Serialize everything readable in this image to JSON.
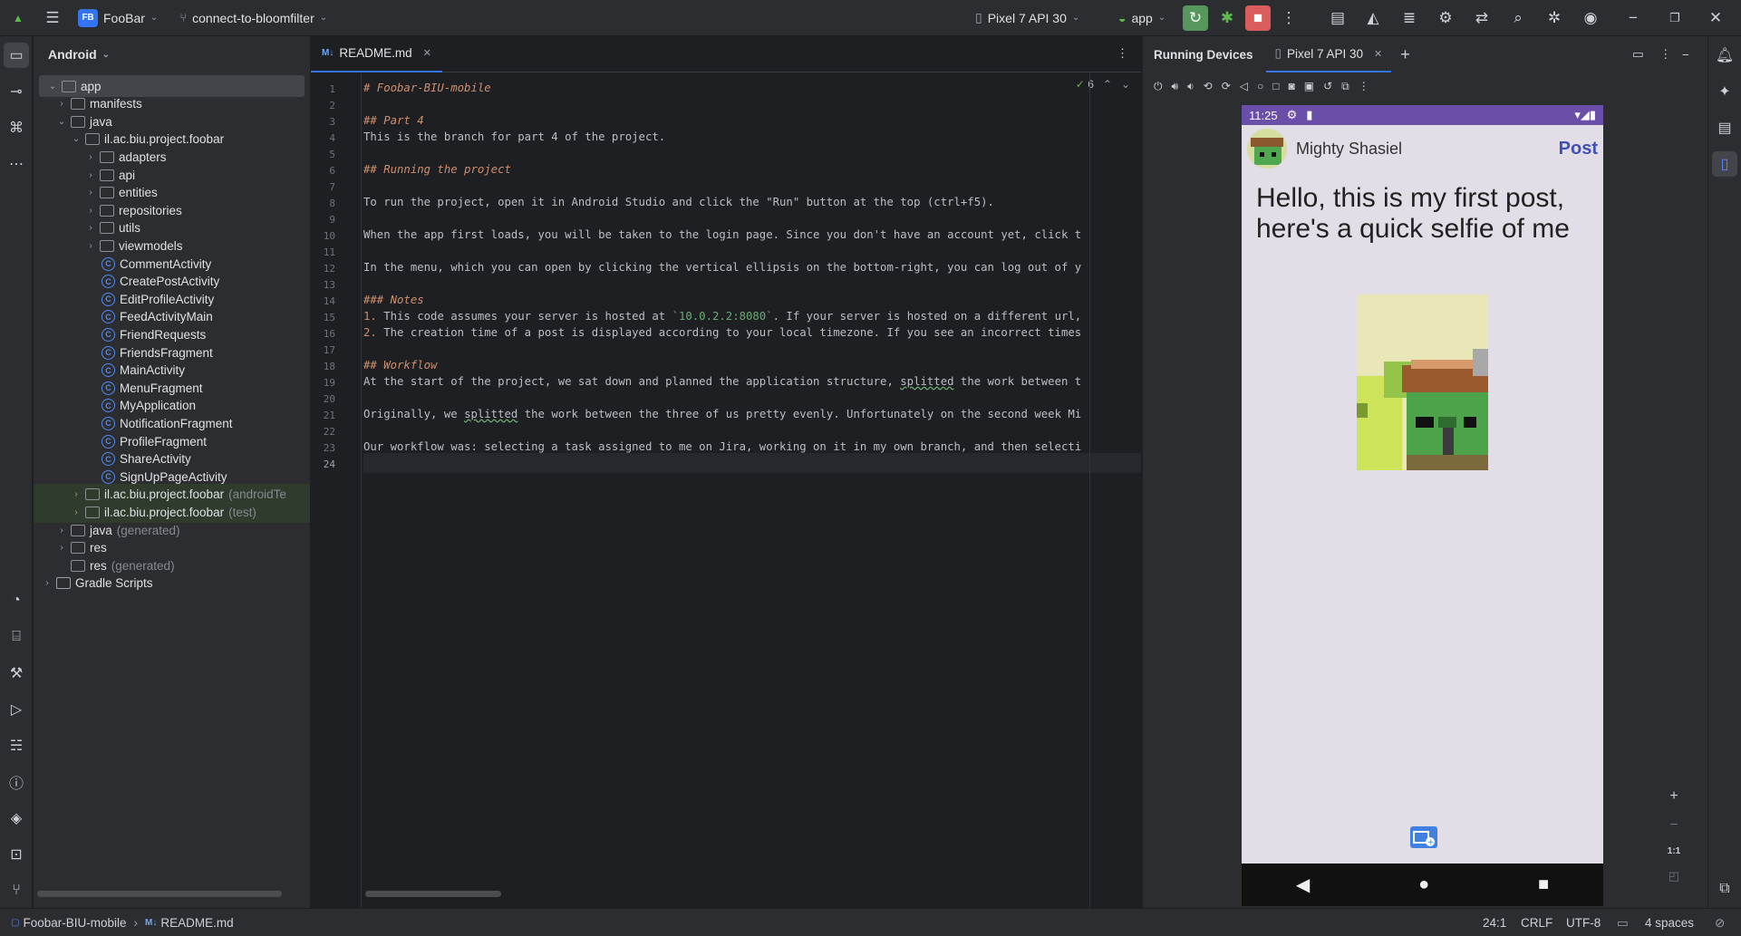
{
  "titlebar": {
    "project_badge": "FB",
    "project_name": "FooBar",
    "branch": "connect-to-bloomfilter",
    "device": "Pixel 7 API 30",
    "run_config": "app"
  },
  "project_panel": {
    "view_mode": "Android",
    "tree": [
      {
        "label": "app",
        "suffix": "",
        "kind": "module",
        "expanded": true
      },
      {
        "label": "manifests",
        "suffix": "",
        "kind": "folder"
      },
      {
        "label": "java",
        "suffix": "",
        "kind": "folder",
        "expanded": true
      },
      {
        "label": "il.ac.biu.project.foobar",
        "suffix": "",
        "kind": "package",
        "expanded": true
      },
      {
        "label": "adapters",
        "suffix": "",
        "kind": "package"
      },
      {
        "label": "api",
        "suffix": "",
        "kind": "package"
      },
      {
        "label": "entities",
        "suffix": "",
        "kind": "package"
      },
      {
        "label": "repositories",
        "suffix": "",
        "kind": "package"
      },
      {
        "label": "utils",
        "suffix": "",
        "kind": "package"
      },
      {
        "label": "viewmodels",
        "suffix": "",
        "kind": "package"
      },
      {
        "label": "CommentActivity",
        "suffix": "",
        "kind": "class"
      },
      {
        "label": "CreatePostActivity",
        "suffix": "",
        "kind": "class"
      },
      {
        "label": "EditProfileActivity",
        "suffix": "",
        "kind": "class"
      },
      {
        "label": "FeedActivityMain",
        "suffix": "",
        "kind": "class"
      },
      {
        "label": "FriendRequests",
        "suffix": "",
        "kind": "class"
      },
      {
        "label": "FriendsFragment",
        "suffix": "",
        "kind": "class"
      },
      {
        "label": "MainActivity",
        "suffix": "",
        "kind": "class"
      },
      {
        "label": "MenuFragment",
        "suffix": "",
        "kind": "class"
      },
      {
        "label": "MyApplication",
        "suffix": "",
        "kind": "class"
      },
      {
        "label": "NotificationFragment",
        "suffix": "",
        "kind": "class"
      },
      {
        "label": "ProfileFragment",
        "suffix": "",
        "kind": "class"
      },
      {
        "label": "ShareActivity",
        "suffix": "",
        "kind": "class"
      },
      {
        "label": "SignUpPageActivity",
        "suffix": "",
        "kind": "class"
      },
      {
        "label": "il.ac.biu.project.foobar",
        "suffix": "(androidTe",
        "kind": "package-test"
      },
      {
        "label": "il.ac.biu.project.foobar",
        "suffix": "(test)",
        "kind": "package-test"
      },
      {
        "label": "java",
        "suffix": "(generated)",
        "kind": "folder"
      },
      {
        "label": "res",
        "suffix": "",
        "kind": "folder"
      },
      {
        "label": "res",
        "suffix": "(generated)",
        "kind": "folder-noarrow"
      },
      {
        "label": "Gradle Scripts",
        "suffix": "",
        "kind": "gradle"
      }
    ]
  },
  "editor": {
    "tab_badge": "M↓",
    "tab_label": "README.md",
    "inspections_count": "6",
    "lines": [
      {
        "n": "1",
        "text": "# Foobar-BIU-mobile",
        "style": "head"
      },
      {
        "n": "2",
        "text": "",
        "style": ""
      },
      {
        "n": "3",
        "text": "## Part 4",
        "style": "head"
      },
      {
        "n": "4",
        "text": "This is the branch for part 4 of the project.",
        "style": ""
      },
      {
        "n": "5",
        "text": "",
        "style": ""
      },
      {
        "n": "6",
        "text": "## Running the project",
        "style": "head"
      },
      {
        "n": "7",
        "text": "",
        "style": ""
      },
      {
        "n": "8",
        "text": "To run the project, open it in Android Studio and click the \"Run\" button at the top (ctrl+f5).",
        "style": ""
      },
      {
        "n": "9",
        "text": "",
        "style": ""
      },
      {
        "n": "10",
        "text": "When the app first loads, you will be taken to the login page. Since you don't have an account yet, click t",
        "style": ""
      },
      {
        "n": "11",
        "text": "",
        "style": ""
      },
      {
        "n": "12",
        "text": "In the menu, which you can open by clicking the vertical ellipsis on the bottom-right, you can log out of y",
        "style": ""
      },
      {
        "n": "13",
        "text": "",
        "style": ""
      },
      {
        "n": "14",
        "text": "### Notes",
        "style": "head"
      },
      {
        "n": "15",
        "text": "1. This code assumes your server is hosted at `10.0.2.2:8080`. If your server is hosted on a different url,",
        "style": "list"
      },
      {
        "n": "16",
        "text": "2. The creation time of a post is displayed according to your local timezone. If you see an incorrect times",
        "style": "list"
      },
      {
        "n": "17",
        "text": "",
        "style": ""
      },
      {
        "n": "18",
        "text": "## Workflow",
        "style": "head"
      },
      {
        "n": "19",
        "text": "At the start of the project, we sat down and planned the application structure, splitted the work between t",
        "style": ""
      },
      {
        "n": "20",
        "text": "",
        "style": ""
      },
      {
        "n": "21",
        "text": "Originally, we splitted the work between the three of us pretty evenly. Unfortunately on the second week Mi",
        "style": ""
      },
      {
        "n": "22",
        "text": "",
        "style": ""
      },
      {
        "n": "23",
        "text": "Our workflow was: selecting a task assigned to me on Jira, working on it in my own branch, and then selecti",
        "style": ""
      },
      {
        "n": "24",
        "text": "",
        "style": "cur"
      }
    ]
  },
  "devices": {
    "panel_title": "Running Devices",
    "tab_label": "Pixel 7 API 30"
  },
  "phone": {
    "time": "11:25",
    "username": "Mighty Shasiel",
    "post_button": "Post",
    "post_text": "Hello, this is my first post, here's a quick selfie of me"
  },
  "zoom": {
    "actual": "1:1"
  },
  "statusbar": {
    "project": "Foobar-BIU-mobile",
    "file_badge": "M↓",
    "file": "README.md",
    "position": "24:1",
    "line_sep": "CRLF",
    "encoding": "UTF-8",
    "indent": "4 spaces"
  },
  "colors": {
    "accent": "#3574f0",
    "run": "#57965c",
    "stop": "#db5c5c",
    "phone_status": "#6a4ea8",
    "post_button": "#3f51b5"
  }
}
